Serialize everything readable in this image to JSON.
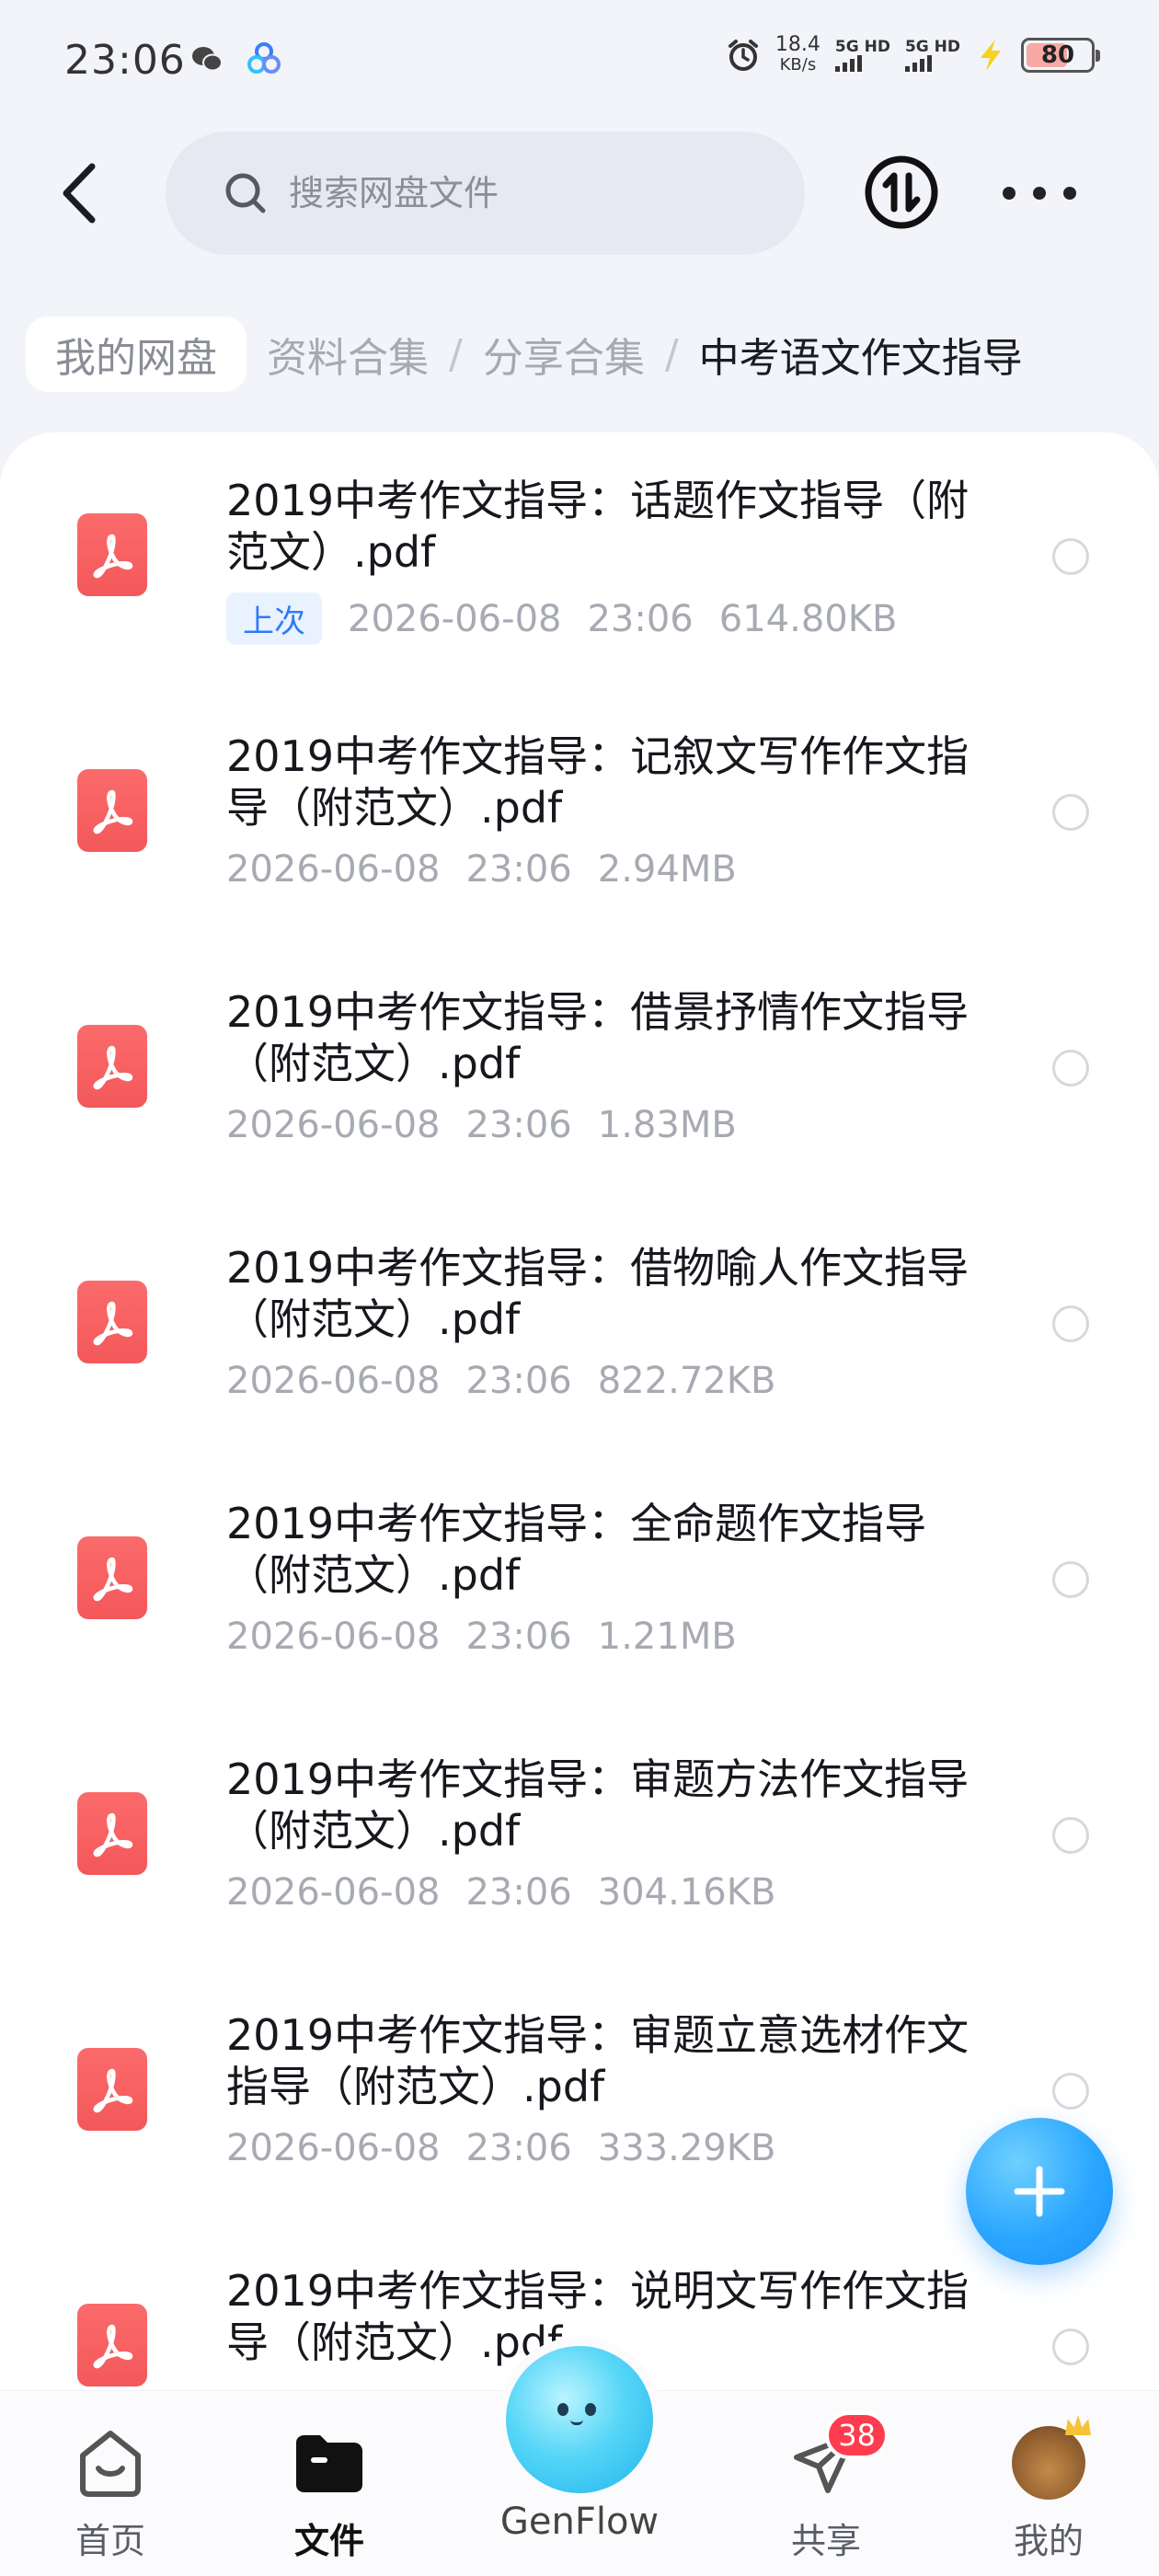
{
  "status_bar": {
    "time": "23:06",
    "net_speed_value": "18.4",
    "net_speed_unit": "KB/s",
    "sim1": "5G HD",
    "sim2": "5G HD",
    "battery": "80"
  },
  "top_bar": {
    "search_placeholder": "搜索网盘文件"
  },
  "breadcrumb": {
    "home": "我的网盘",
    "trail": [
      "资料合集",
      "分享合集"
    ],
    "current": "中考语文作文指导",
    "separator": "/"
  },
  "files": [
    {
      "name": "2019中考作文指导：话题作文指导（附范文）.pdf",
      "tag": "上次",
      "date": "2026-06-08",
      "time": "23:06",
      "size": "614.80KB"
    },
    {
      "name": "2019中考作文指导：记叙文写作作文指导（附范文）.pdf",
      "tag": "",
      "date": "2026-06-08",
      "time": "23:06",
      "size": "2.94MB"
    },
    {
      "name": "2019中考作文指导：借景抒情作文指导（附范文）.pdf",
      "tag": "",
      "date": "2026-06-08",
      "time": "23:06",
      "size": "1.83MB"
    },
    {
      "name": "2019中考作文指导：借物喻人作文指导（附范文）.pdf",
      "tag": "",
      "date": "2026-06-08",
      "time": "23:06",
      "size": "822.72KB"
    },
    {
      "name": "2019中考作文指导：全命题作文指导（附范文）.pdf",
      "tag": "",
      "date": "2026-06-08",
      "time": "23:06",
      "size": "1.21MB"
    },
    {
      "name": "2019中考作文指导：审题方法作文指导（附范文）.pdf",
      "tag": "",
      "date": "2026-06-08",
      "time": "23:06",
      "size": "304.16KB"
    },
    {
      "name": "2019中考作文指导：审题立意选材作文指导（附范文）.pdf",
      "tag": "",
      "date": "2026-06-08",
      "time": "23:06",
      "size": "333.29KB"
    },
    {
      "name": "2019中考作文指导：说明文写作作文指导（附范文）.pdf",
      "tag": "",
      "date": "",
      "time": "",
      "size": ""
    }
  ],
  "bottom_nav": {
    "home": "首页",
    "files": "文件",
    "genflow": "GenFlow",
    "share": "共享",
    "share_badge": "38",
    "me": "我的"
  },
  "icons": {
    "back": "chevron-left-icon",
    "search": "search-icon",
    "sort": "transfer-icon",
    "more": "more-dots-icon",
    "file": "pdf-icon",
    "fab": "plus-icon"
  },
  "colors": {
    "accent": "#2aa6ff",
    "pdf": "#f3585a",
    "badge": "#ff3b4e",
    "tag_bg": "#e9f2ff",
    "tag_text": "#2e7bf6"
  }
}
